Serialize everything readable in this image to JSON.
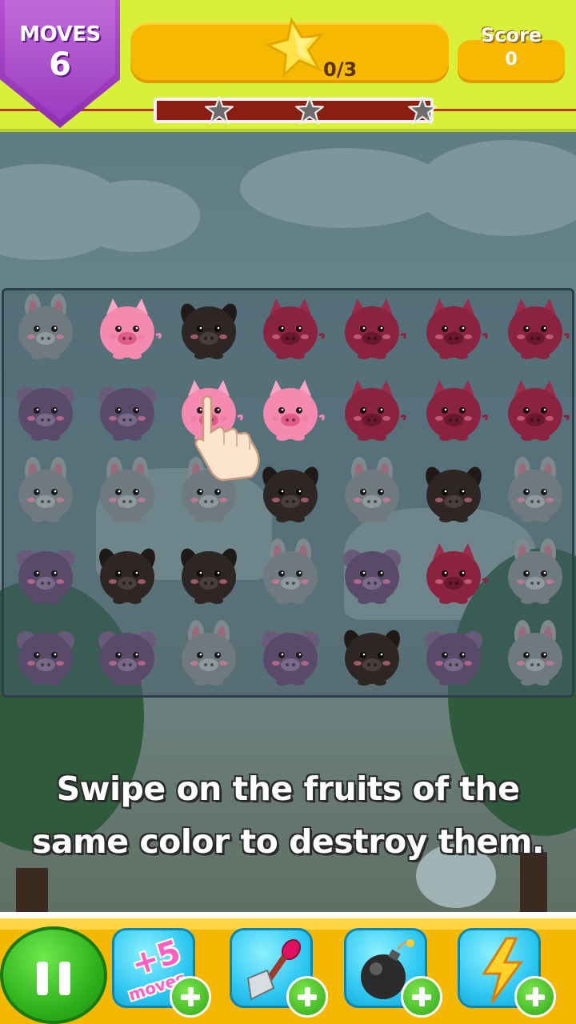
{
  "hud": {
    "moves_label": "MOVES",
    "moves_value": "6",
    "stars_progress": "0/3",
    "score_label": "Score",
    "score_value": "0",
    "progress_fraction": 0
  },
  "board": {
    "rows": 5,
    "cols": 7,
    "grid": [
      [
        "bunny",
        "pig",
        "dog",
        "pig-dark",
        "pig-dark",
        "pig-dark",
        "pig-dark"
      ],
      [
        "mouse",
        "mouse",
        "pig",
        "pig",
        "pig-dark",
        "pig-dark",
        "pig-dark"
      ],
      [
        "bunny",
        "bunny",
        "bunny",
        "dog",
        "bunny",
        "dog",
        "bunny"
      ],
      [
        "mouse",
        "dog",
        "dog",
        "bunny",
        "mouse",
        "pig-dark",
        "bunny"
      ],
      [
        "mouse",
        "mouse",
        "bunny",
        "mouse",
        "dog",
        "mouse",
        "bunny"
      ]
    ],
    "highlighted": [
      [
        0,
        1
      ],
      [
        1,
        2
      ],
      [
        1,
        3
      ]
    ]
  },
  "tutorial": {
    "line1": "Swipe on the fruits of the",
    "line2": "same color to destroy them."
  },
  "boosters": {
    "extra_moves_number": "+5",
    "extra_moves_label": "moves",
    "items": [
      "extra-moves-booster",
      "shovel-booster",
      "bomb-booster",
      "lightning-booster"
    ]
  },
  "colors": {
    "topbar": "#d8f03a",
    "moves_badge": "#9a3cc0",
    "panel": "#f6b800",
    "pause": "#2fb31c",
    "booster": "#2ec7f2"
  }
}
